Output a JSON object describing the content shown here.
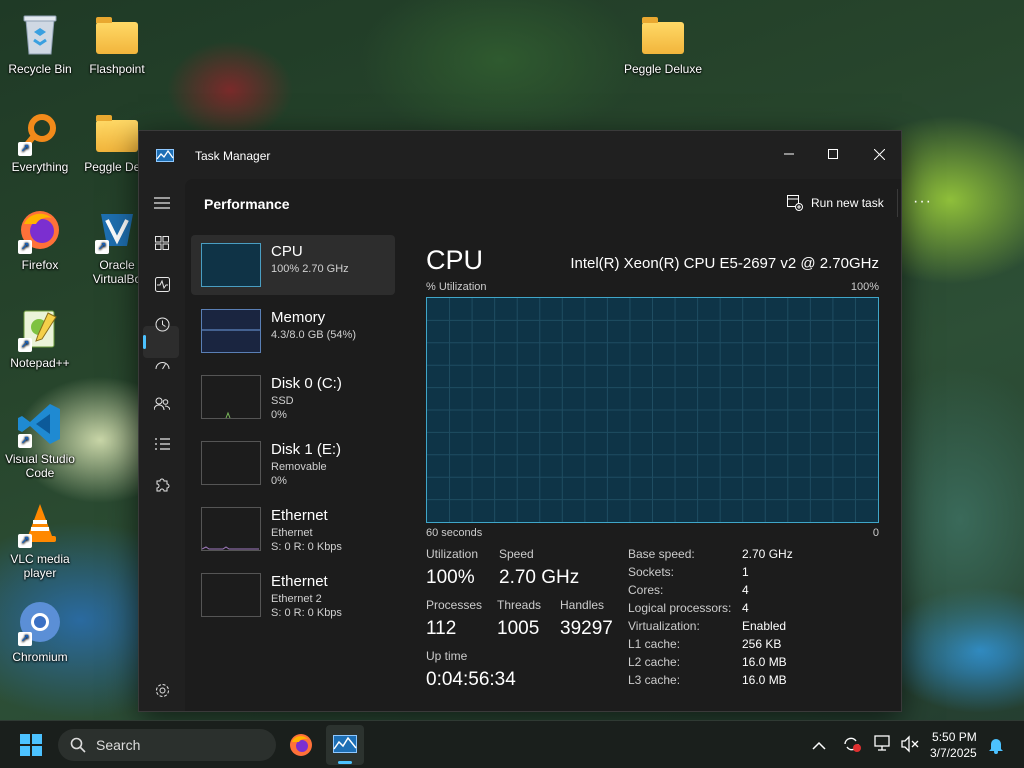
{
  "desktop": {
    "icons": [
      {
        "label": "Recycle Bin"
      },
      {
        "label": "Flashpoint"
      },
      {
        "label": "Peggle Deluxe"
      },
      {
        "label": "Everything"
      },
      {
        "label": "Peggle Delu"
      },
      {
        "label": "Firefox"
      },
      {
        "label": "Oracle VirtualBo"
      },
      {
        "label": "Notepad++"
      },
      {
        "label": "Visual Studio Code"
      },
      {
        "label": "VLC media player"
      },
      {
        "label": "Chromium"
      }
    ]
  },
  "window": {
    "title": "Task Manager",
    "page_title": "Performance",
    "run_new_task": "Run new task",
    "more": "···"
  },
  "list": [
    {
      "name": "CPU",
      "sub1": "100% 2.70 GHz"
    },
    {
      "name": "Memory",
      "sub1": "4.3/8.0 GB (54%)"
    },
    {
      "name": "Disk 0 (C:)",
      "sub1": "SSD",
      "sub2": "0%"
    },
    {
      "name": "Disk 1 (E:)",
      "sub1": "Removable",
      "sub2": "0%"
    },
    {
      "name": "Ethernet",
      "sub1": "Ethernet",
      "sub2": "S: 0 R: 0 Kbps"
    },
    {
      "name": "Ethernet",
      "sub1": "Ethernet 2",
      "sub2": "S: 0 R: 0 Kbps"
    }
  ],
  "cpu": {
    "title": "CPU",
    "model": "Intel(R) Xeon(R) CPU E5-2697 v2 @ 2.70GHz",
    "util_label": "% Utilization",
    "util_max": "100%",
    "x_label": "60 seconds",
    "x_min": "0",
    "utilization_label": "Utilization",
    "utilization": "100%",
    "speed_label": "Speed",
    "speed": "2.70 GHz",
    "processes_label": "Processes",
    "processes": "112",
    "threads_label": "Threads",
    "threads": "1005",
    "handles_label": "Handles",
    "handles": "39297",
    "uptime_label": "Up time",
    "uptime": "0:04:56:34",
    "specs": [
      {
        "label": "Base speed:",
        "value": "2.70 GHz"
      },
      {
        "label": "Sockets:",
        "value": "1"
      },
      {
        "label": "Cores:",
        "value": "4"
      },
      {
        "label": "Logical processors:",
        "value": "4"
      },
      {
        "label": "Virtualization:",
        "value": "Enabled"
      },
      {
        "label": "L1 cache:",
        "value": "256 KB"
      },
      {
        "label": "L2 cache:",
        "value": "16.0 MB"
      },
      {
        "label": "L3 cache:",
        "value": "16.0 MB"
      }
    ]
  },
  "taskbar": {
    "search_label": "Search",
    "time": "5:50 PM",
    "date": "3/7/2025"
  },
  "colors": {
    "accent": "#4cc2ff",
    "graph_fill": "#0e3447",
    "graph_border": "#3fa6c9"
  }
}
